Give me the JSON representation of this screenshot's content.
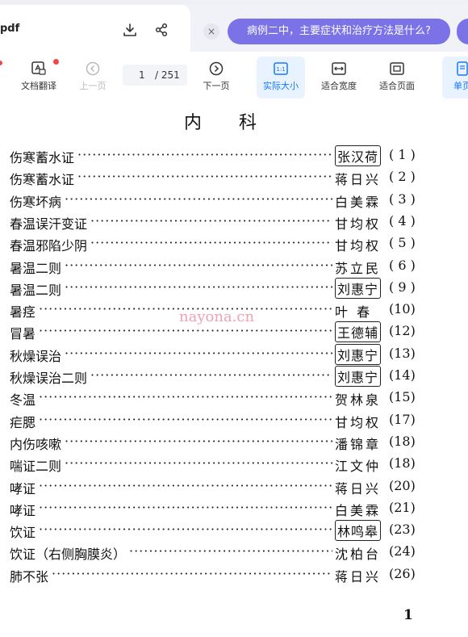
{
  "app": {
    "filename": "pdf",
    "chat_suggestion": "病例二中，主要症状和治疗方法是什么?",
    "close_glyph": "×"
  },
  "toolbar": {
    "translate": "文档翻译",
    "prev": "上一页",
    "current_page": "1",
    "total_pages": "/ 251",
    "next": "下一页",
    "actual_size": "实际大小",
    "fit_width": "适合宽度",
    "fit_page": "适合页面",
    "single_page": "单页"
  },
  "document": {
    "title": "内科",
    "watermark": "nayona.cn",
    "page_number": "1",
    "rows": [
      {
        "title": "伤寒蓄水证",
        "author": "张汉荷",
        "page": "( 1 )",
        "boxed": true
      },
      {
        "title": "伤寒蓄水证",
        "author": "蒋日兴",
        "page": "( 2 )",
        "boxed": false
      },
      {
        "title": "伤寒坏病",
        "author": "白美霖",
        "page": "( 3 )",
        "boxed": false
      },
      {
        "title": "春温误汗变证",
        "author": "甘均权",
        "page": "( 4 )",
        "boxed": false
      },
      {
        "title": "春温邪陷少阴",
        "author": "甘均权",
        "page": "( 5 )",
        "boxed": false
      },
      {
        "title": "暑温二则",
        "author": "苏立民",
        "page": "( 6 )",
        "boxed": false
      },
      {
        "title": "暑温二则",
        "author": "刘惠宁",
        "page": "( 9 )",
        "boxed": true
      },
      {
        "title": "暑痉",
        "author": "叶 春",
        "page": "(10)",
        "boxed": false
      },
      {
        "title": "冒暑",
        "author": "王德辅",
        "page": "(12)",
        "boxed": true
      },
      {
        "title": "秋燥误治",
        "author": "刘惠宁",
        "page": "(13)",
        "boxed": true
      },
      {
        "title": "秋燥误治二则",
        "author": "刘惠宁",
        "page": "(14)",
        "boxed": true
      },
      {
        "title": "冬温",
        "author": "贺林泉",
        "page": "(15)",
        "boxed": false
      },
      {
        "title": "疟腮",
        "author": "甘均权",
        "page": "(17)",
        "boxed": false
      },
      {
        "title": "内伤咳嗽",
        "author": "潘锦章",
        "page": "(18)",
        "boxed": false
      },
      {
        "title": "喘证二则",
        "author": "江文仲",
        "page": "(18)",
        "boxed": false
      },
      {
        "title": "哮证",
        "author": "蒋日兴",
        "page": "(20)",
        "boxed": false
      },
      {
        "title": "哮证",
        "author": "白美霖",
        "page": "(21)",
        "boxed": false
      },
      {
        "title": "饮证",
        "author": "林鸣皋",
        "page": "(23)",
        "boxed": true
      },
      {
        "title": "饮证（右侧胸膜炎）",
        "author": "沈柏台",
        "page": "(24)",
        "boxed": false
      },
      {
        "title": "肺不张",
        "author": "蒋日兴",
        "page": "(26)",
        "boxed": false
      }
    ]
  },
  "colors": {
    "accent": "#7a72e6",
    "active_tool_bg": "#e8f3ff",
    "active_tool_fg": "#1677ff",
    "badge": "#f04848"
  },
  "icons": [
    "download-icon",
    "share-icon",
    "translate-icon",
    "prev-icon",
    "next-icon",
    "actual-size-icon",
    "fit-width-icon",
    "fit-page-icon",
    "single-page-icon"
  ]
}
